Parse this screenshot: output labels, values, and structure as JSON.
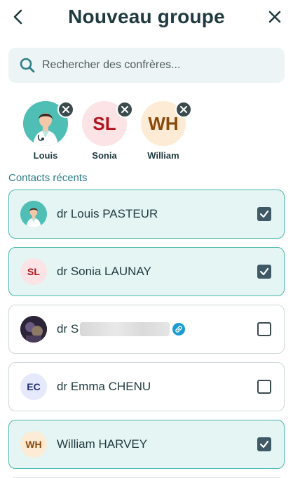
{
  "header": {
    "title": "Nouveau groupe",
    "back_icon": "chevron-left-icon",
    "close_icon": "close-icon"
  },
  "search": {
    "placeholder": "Rechercher des confrères...",
    "value": "",
    "icon": "search-icon"
  },
  "selected": [
    {
      "name": "Louis",
      "initials": "",
      "avatar": "doctor-illustration",
      "avatar_bg": "#4fbfb6"
    },
    {
      "name": "Sonia",
      "initials": "SL",
      "avatar_bg": "#fbe3e6",
      "text_color": "#b1141c"
    },
    {
      "name": "William",
      "initials": "WH",
      "avatar_bg": "#fdebd6",
      "text_color": "#8a4a0c"
    }
  ],
  "recent": {
    "title": "Contacts récents",
    "contacts": [
      {
        "name": "dr Louis PASTEUR",
        "initials": "",
        "avatar": "doctor-illustration",
        "avatar_bg": "#4fbfb6",
        "checked": true
      },
      {
        "name": "dr Sonia LAUNAY",
        "initials": "SL",
        "avatar_bg": "#fbe3e6",
        "text_color": "#b1141c",
        "checked": true
      },
      {
        "name": "dr S",
        "initials": "",
        "avatar": "photo",
        "avatar_bg": "#3c2f49",
        "checked": false,
        "name_obscured": true,
        "badge": "link-icon"
      },
      {
        "name": "dr Emma CHENU",
        "initials": "EC",
        "avatar_bg": "#e6e9fb",
        "text_color": "#1f2f77",
        "checked": false
      },
      {
        "name": "William HARVEY",
        "initials": "WH",
        "avatar_bg": "#fdebd6",
        "text_color": "#8a4a0c",
        "checked": true
      }
    ]
  },
  "colors": {
    "accent": "#4cb8b0",
    "checked_card_bg": "#e4f5f3",
    "checkbox_on": "#3f5a66",
    "section_title": "#2e7f86"
  }
}
